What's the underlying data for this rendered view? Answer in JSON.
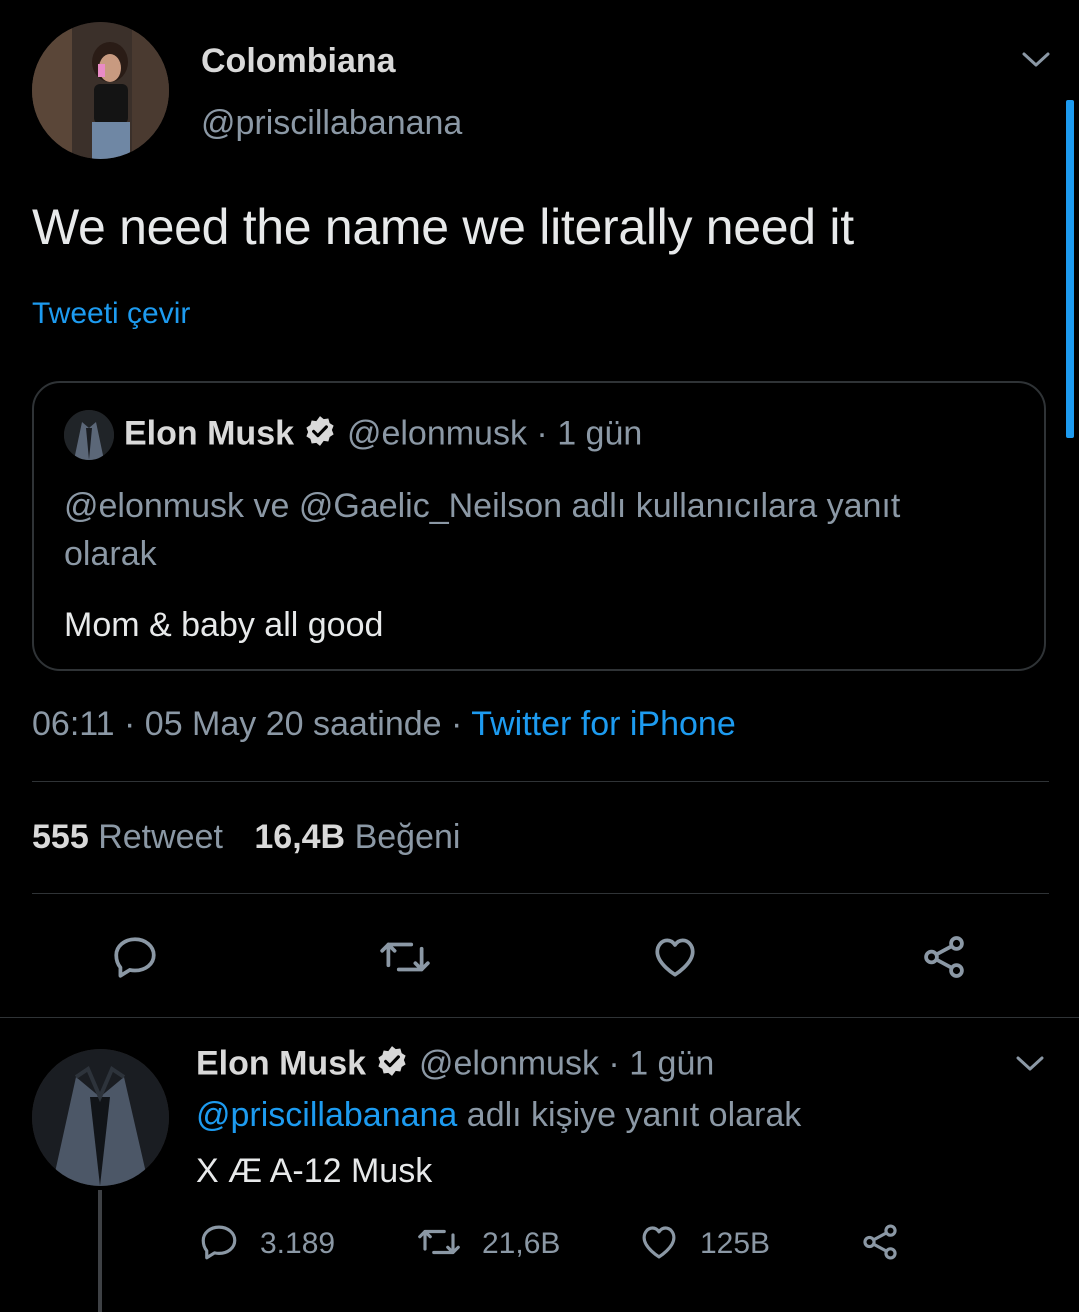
{
  "author": {
    "display_name": "Colombiana",
    "handle": "@priscillabanana"
  },
  "tweet": {
    "text": "We need the name we literally need it",
    "translate_link": "Tweeti çevir"
  },
  "quoted": {
    "display_name": "Elon Musk",
    "handle": "@elonmusk",
    "separator": "·",
    "time": "1 gün",
    "reply_context": "@elonmusk ve @Gaelic_Neilson adlı kullanıcılara yanıt olarak",
    "text": "Mom & baby all good"
  },
  "meta": {
    "time": "06:11",
    "sep1": "·",
    "date": "05 May 20 saatinde",
    "sep2": "·",
    "client": "Twitter for iPhone"
  },
  "stats": {
    "retweet_count": "555",
    "retweet_label": "Retweet",
    "like_count": "16,4B",
    "like_label": "Beğeni"
  },
  "actions": [
    "reply-icon",
    "retweet-icon",
    "like-icon",
    "share-icon"
  ],
  "reply": {
    "display_name": "Elon Musk",
    "handle": "@elonmusk",
    "separator": "·",
    "time": "1 gün",
    "reply_to": "@priscillabanana",
    "reply_suffix": "adlı kişiye yanıt olarak",
    "text": "X Æ A-12 Musk",
    "reply_count": "3.189",
    "retweet_count": "21,6B",
    "like_count": "125B"
  },
  "colors": {
    "background": "#000000",
    "accent": "#1d9bf0",
    "muted": "#8b98a5",
    "text": "#d9d9d9",
    "divider": "#2f3336"
  }
}
